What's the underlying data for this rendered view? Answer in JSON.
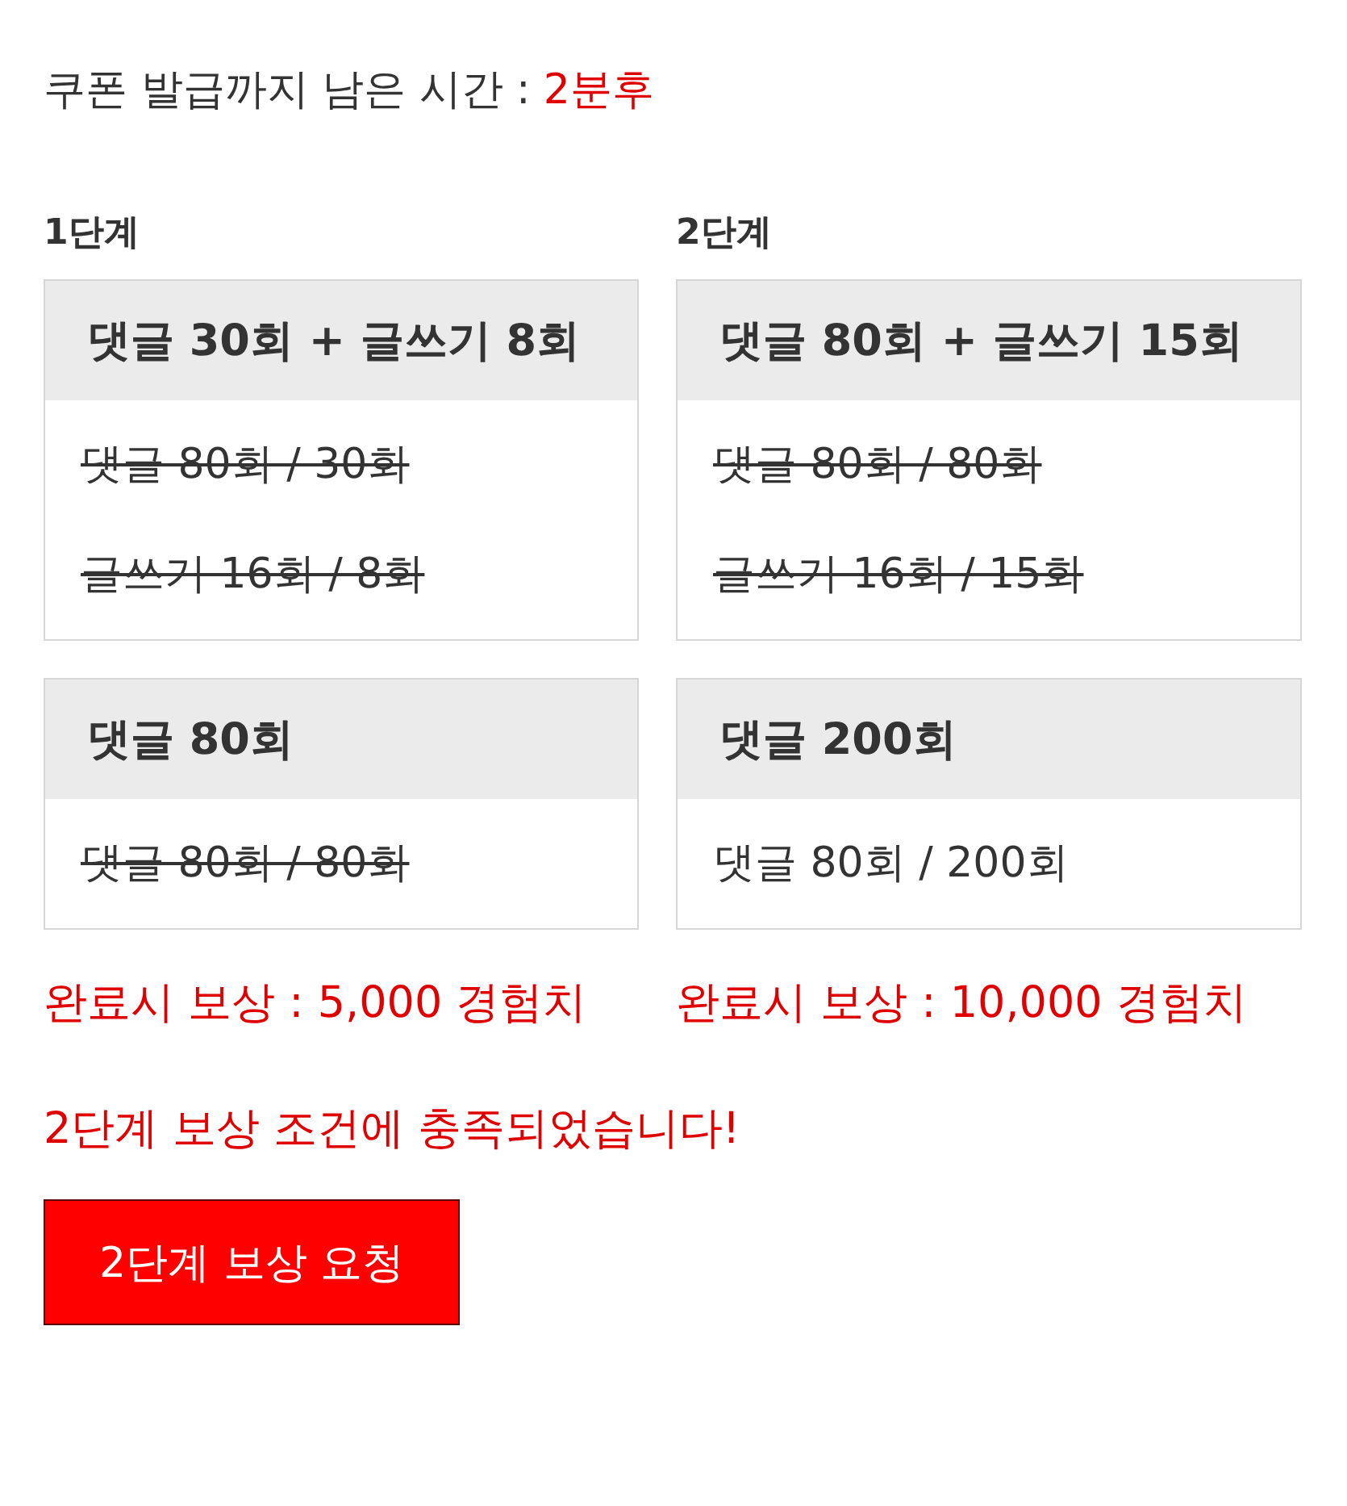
{
  "coupon": {
    "label": "쿠폰 발급까지 남은 시간 :",
    "value": "2분후"
  },
  "stages": [
    {
      "title": "1단계",
      "cards": [
        {
          "heading": "댓글 30회 + 글쓰기 8회",
          "items": [
            {
              "text": "댓글 80회 / 30회",
              "completed": true
            },
            {
              "text": "글쓰기 16회 / 8회",
              "completed": true
            }
          ]
        },
        {
          "heading": "댓글 80회",
          "items": [
            {
              "text": "댓글 80회 / 80회",
              "completed": true
            }
          ]
        }
      ],
      "reward": "완료시 보상 : 5,000 경험치"
    },
    {
      "title": "2단계",
      "cards": [
        {
          "heading": "댓글 80회 + 글쓰기 15회",
          "items": [
            {
              "text": "댓글 80회 / 80회",
              "completed": true
            },
            {
              "text": "글쓰기 16회 / 15회",
              "completed": true
            }
          ]
        },
        {
          "heading": "댓글 200회",
          "items": [
            {
              "text": "댓글 80회 / 200회",
              "completed": false
            }
          ]
        }
      ],
      "reward": "완료시 보상 : 10,000 경험치"
    }
  ],
  "message": "2단계 보상 조건에 충족되었습니다!",
  "button": "2단계 보상 요청"
}
